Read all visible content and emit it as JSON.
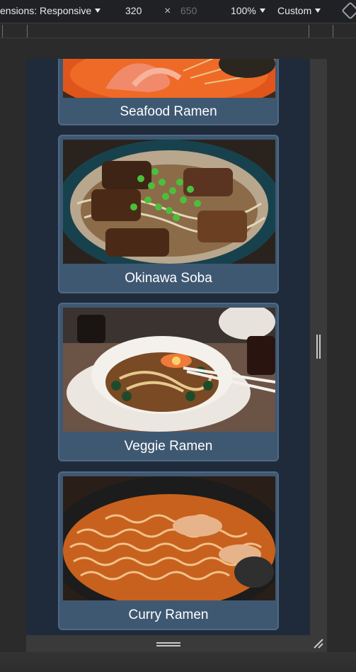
{
  "toolbar": {
    "dimensions_label": "ensions: Responsive",
    "width_value": "320",
    "times_symbol": "×",
    "height_placeholder": "650",
    "zoom_label": "100%",
    "throttle_label": "Custom"
  },
  "cards": [
    {
      "title": "Seafood Ramen"
    },
    {
      "title": "Okinawa Soba"
    },
    {
      "title": "Veggie Ramen"
    },
    {
      "title": "Curry Ramen"
    }
  ],
  "colors": {
    "page_background": "#1f2b3b",
    "card_background": "#3f5872",
    "card_border": "#4d6986",
    "caption_text": "#ffffff"
  }
}
